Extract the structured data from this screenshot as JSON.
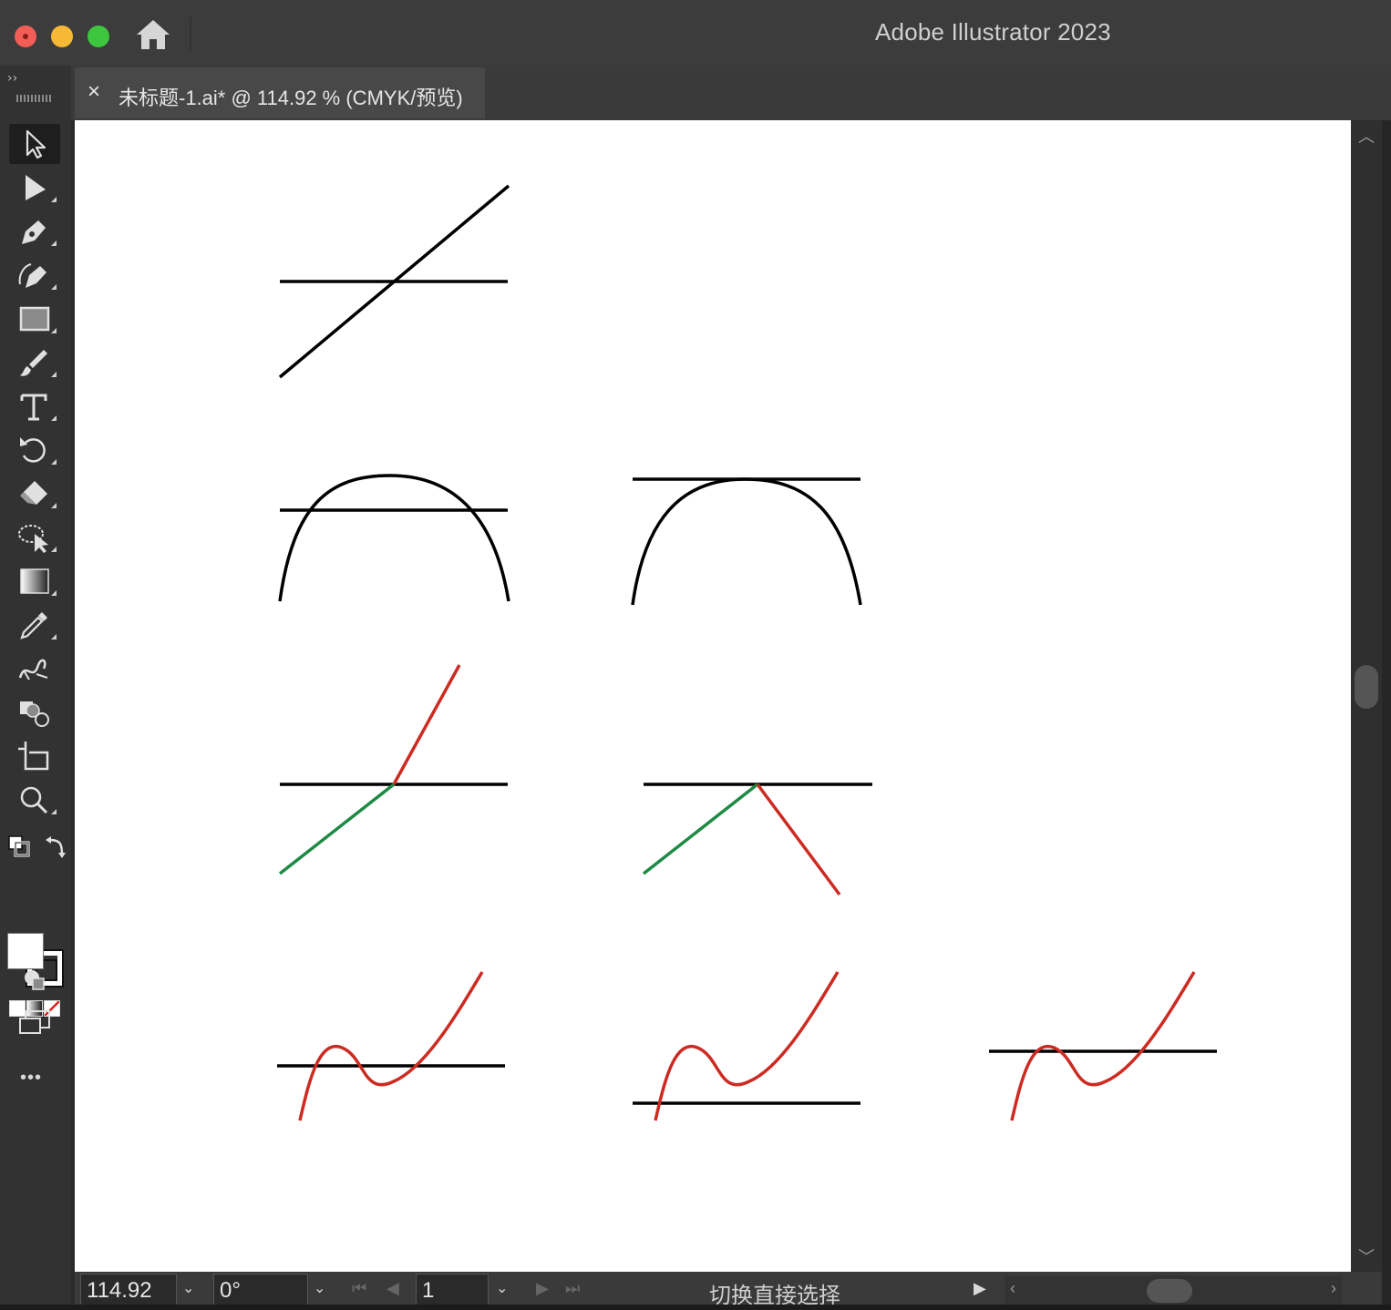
{
  "window": {
    "title": "Adobe Illustrator 2023",
    "controls": [
      "close-button",
      "minimize-button",
      "maximize-button"
    ]
  },
  "header": {
    "home_icon": "home-icon"
  },
  "document_tab": {
    "close_glyph": "×",
    "title": "未标题-1.ai* @ 114.92 % (CMYK/预览)"
  },
  "toolbar": {
    "collapse_glyph": "››",
    "tools": [
      {
        "name": "selection-tool",
        "icon": "arrow-outline-icon",
        "active": true
      },
      {
        "name": "direct-selection-tool",
        "icon": "arrow-filled-icon"
      },
      {
        "name": "pen-tool",
        "icon": "pen-icon"
      },
      {
        "name": "curvature-tool",
        "icon": "curvature-pen-icon"
      },
      {
        "name": "rectangle-tool",
        "icon": "rectangle-icon"
      },
      {
        "name": "paintbrush-tool",
        "icon": "brush-icon"
      },
      {
        "name": "type-tool",
        "icon": "type-icon"
      },
      {
        "name": "rotate-tool",
        "icon": "rotate-icon"
      },
      {
        "name": "eraser-tool",
        "icon": "eraser-icon"
      },
      {
        "name": "lasso-tool",
        "icon": "lasso-icon"
      },
      {
        "name": "gradient-tool",
        "icon": "gradient-icon"
      },
      {
        "name": "eyedropper-tool",
        "icon": "eyedropper-icon"
      },
      {
        "name": "blend-tool",
        "icon": "blend-icon"
      },
      {
        "name": "shape-builder-tool",
        "icon": "shape-builder-icon"
      },
      {
        "name": "artboard-tool",
        "icon": "artboard-icon"
      },
      {
        "name": "zoom-tool",
        "icon": "magnifier-icon"
      }
    ],
    "more_label": "•••"
  },
  "colors": {
    "black_stroke": "#000000",
    "red_stroke": "#cc2b22",
    "green_stroke": "#1e8a44",
    "canvas": "#ffffff",
    "ui_dark": "#323232"
  },
  "statusbar": {
    "zoom_value": "114.92",
    "rotation_value": "0°",
    "artboard_value": "1",
    "status_text": "切换直接选择"
  }
}
